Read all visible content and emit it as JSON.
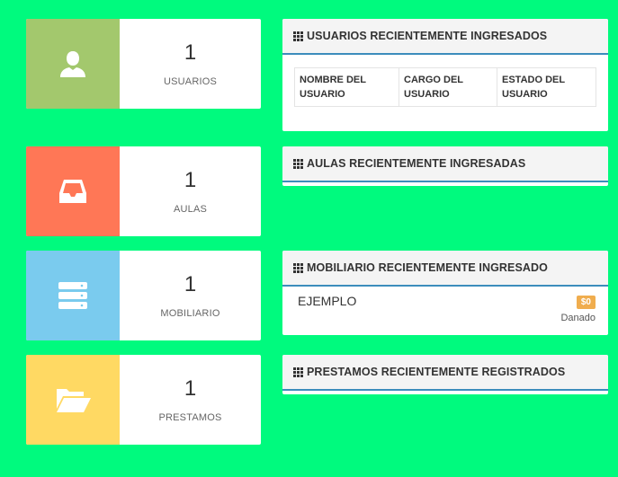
{
  "stats": [
    {
      "count": "1",
      "label": "USUARIOS",
      "color": "#a3c86d",
      "icon": "user-icon"
    },
    {
      "count": "1",
      "label": "AULAS",
      "color": "#ff7756",
      "icon": "inbox-icon"
    },
    {
      "count": "1",
      "label": "MOBILIARIO",
      "color": "#7acbee",
      "icon": "server-icon"
    },
    {
      "count": "1",
      "label": "PRESTAMOS",
      "color": "#ffd963",
      "icon": "folder-open-icon"
    }
  ],
  "panels": {
    "users": {
      "title": "USUARIOS RECIENTEMENTE INGRESADOS",
      "columns": [
        "NOMBRE DEL USUARIO",
        "CARGO DEL USUARIO",
        "ESTADO DEL USUARIO"
      ]
    },
    "rooms": {
      "title": "AULAS RECIENTEMENTE INGRESADAS"
    },
    "furniture": {
      "title": "MOBILIARIO RECIENTEMENTE INGRESADO",
      "items": [
        {
          "name": "EJEMPLO",
          "price": "$0",
          "status": "Danado"
        }
      ]
    },
    "loans": {
      "title": "PRESTAMOS RECIENTEMENTE REGISTRADOS"
    }
  },
  "colors": {
    "background": "#00fa7e",
    "panel_accent": "#3c8dbc",
    "badge": "#f0ad4e"
  }
}
